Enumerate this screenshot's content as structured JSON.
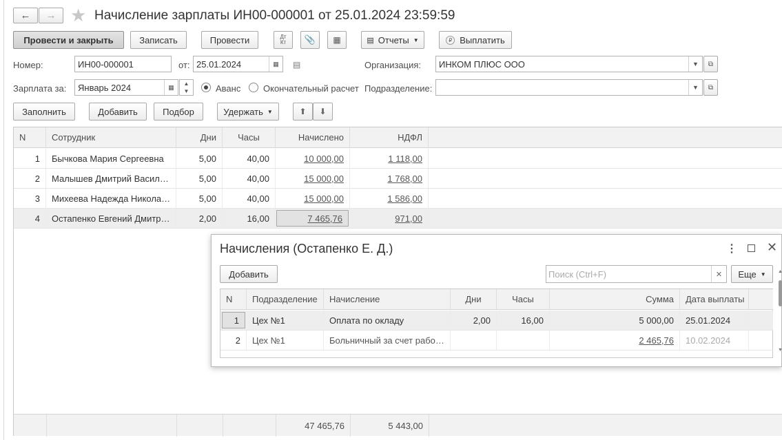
{
  "window": {
    "title": "Начисление зарплаты ИН00-000001 от 25.01.2024 23:59:59"
  },
  "toolbar": {
    "post_close": "Провести и закрыть",
    "save": "Записать",
    "post": "Провести",
    "dt_kt": "Дт\nКт",
    "reports": "Отчеты",
    "pay": "Выплатить"
  },
  "form": {
    "number_label": "Номер:",
    "number_value": "ИН00-000001",
    "from_label": "от:",
    "date_value": "25.01.2024",
    "org_label": "Организация:",
    "org_value": "ИНКОМ ПЛЮС ООО",
    "period_label": "Зарплата за:",
    "period_value": "Январь 2024",
    "advance_label": "Аванс",
    "final_label": "Окончательный расчет",
    "dept_label": "Подразделение:",
    "dept_value": ""
  },
  "table_toolbar": {
    "fill": "Заполнить",
    "add": "Добавить",
    "pick": "Подбор",
    "withhold": "Удержать"
  },
  "main_table": {
    "headers": [
      "N",
      "Сотрудник",
      "Дни",
      "Часы",
      "Начислено",
      "НДФЛ"
    ],
    "rows": [
      {
        "n": "1",
        "name": "Бычкова Мария Сергеевна",
        "days": "5,00",
        "hours": "40,00",
        "accrued": "10 000,00",
        "ndfl": "1 118,00"
      },
      {
        "n": "2",
        "name": "Малышев Дмитрий Васил…",
        "days": "5,00",
        "hours": "40,00",
        "accrued": "15 000,00",
        "ndfl": "1 768,00"
      },
      {
        "n": "3",
        "name": "Михеева Надежда Никола…",
        "days": "5,00",
        "hours": "40,00",
        "accrued": "15 000,00",
        "ndfl": "1 586,00"
      },
      {
        "n": "4",
        "name": "Остапенко Евгений Дмитр…",
        "days": "2,00",
        "hours": "16,00",
        "accrued": "7 465,76",
        "ndfl": "971,00"
      }
    ],
    "totals": {
      "accrued": "47 465,76",
      "ndfl": "5 443,00"
    }
  },
  "popup": {
    "title": "Начисления (Остапенко Е. Д.)",
    "add": "Добавить",
    "search_placeholder": "Поиск (Ctrl+F)",
    "more": "Еще",
    "headers": [
      "N",
      "Подразделение",
      "Начисление",
      "Дни",
      "Часы",
      "Сумма",
      "Дата выплаты"
    ],
    "rows": [
      {
        "n": "1",
        "dept": "Цех №1",
        "type": "Оплата по окладу",
        "days": "2,00",
        "hours": "16,00",
        "sum": "5 000,00",
        "date": "25.01.2024"
      },
      {
        "n": "2",
        "dept": "Цех №1",
        "type": "Больничный за счет рабо…",
        "days": "",
        "hours": "",
        "sum": "2 465,76",
        "date": "10.02.2024"
      }
    ]
  },
  "icons": {
    "back": "arrow-left-icon",
    "forward": "arrow-right-icon",
    "favorite": "star-icon"
  }
}
